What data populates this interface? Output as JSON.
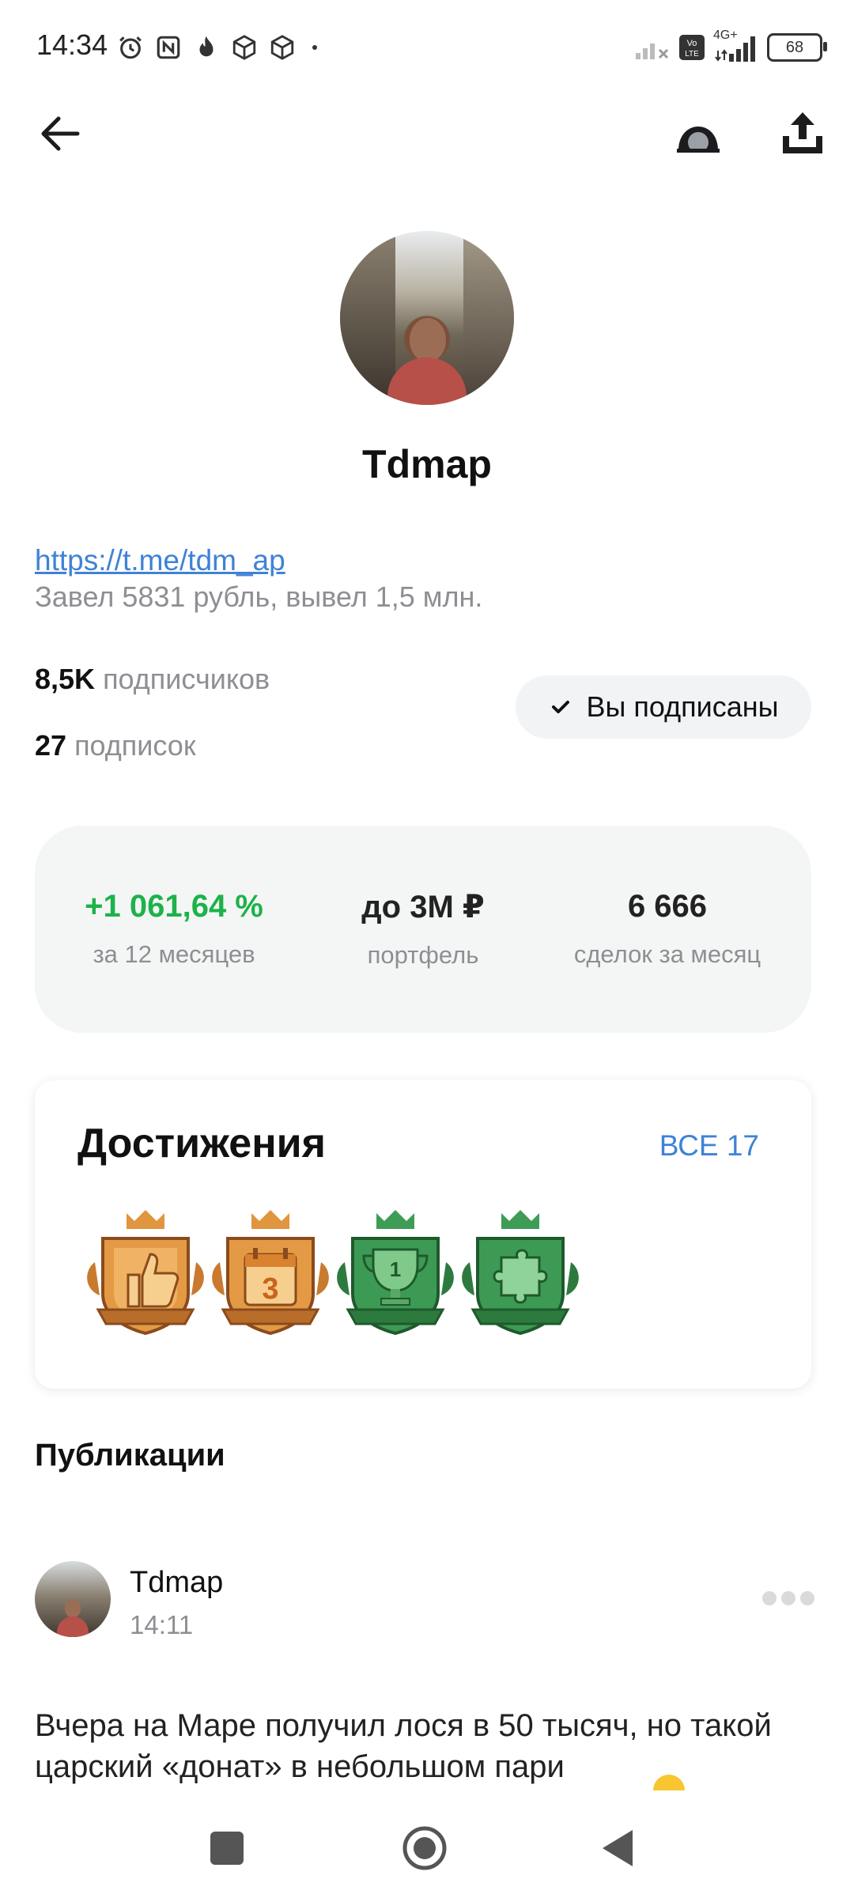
{
  "status_bar": {
    "time": "14:34",
    "network": "4G+",
    "battery": "68",
    "icons": [
      "alarm-icon",
      "nfc-icon",
      "flame-icon",
      "package-icon",
      "package-icon",
      "dot-icon",
      "signal-icon",
      "volte-icon",
      "signal-icon"
    ]
  },
  "toolbar": {
    "icons": [
      "back-arrow-icon",
      "avatar-outline-icon",
      "share-upload-icon"
    ]
  },
  "profile": {
    "name": "Tdmap",
    "link": "https://t.me/tdm_ap",
    "bio": "Завел 5831 рубль, вывел 1,5 млн.",
    "followers_count": "8,5K",
    "followers_label": "подписчиков",
    "following_count": "27",
    "following_label": "подписок",
    "subscribed_label": "Вы подписаны"
  },
  "stats": [
    {
      "value": "+1 061,64 %",
      "label": "за 12 месяцев",
      "color": "#1eb24a"
    },
    {
      "value": "до 3М ₽",
      "label": "портфель"
    },
    {
      "value": "6 666",
      "label": "сделок за месяц"
    }
  ],
  "achievements": {
    "title": "Достижения",
    "all_label": "ВСЕ 17",
    "badges": [
      {
        "icon": "thumbs-up-badge-icon",
        "tier": "bronze"
      },
      {
        "icon": "calendar-3-badge-icon",
        "tier": "bronze",
        "text": "3"
      },
      {
        "icon": "trophy-badge-icon",
        "tier": "green",
        "text": "1"
      },
      {
        "icon": "puzzle-badge-icon",
        "tier": "green"
      }
    ]
  },
  "publications": {
    "heading": "Публикации",
    "post": {
      "author": "Tdmap",
      "time": "14:11",
      "text": "Вчера на Маре получил лося в 50 тысяч, но такой царский «донат» в небольшом пари"
    }
  },
  "colors": {
    "accent_blue": "#3f82d6",
    "positive_green": "#1eb24a",
    "bronze": "#d98b3a",
    "green_badge": "#2f8a45"
  }
}
